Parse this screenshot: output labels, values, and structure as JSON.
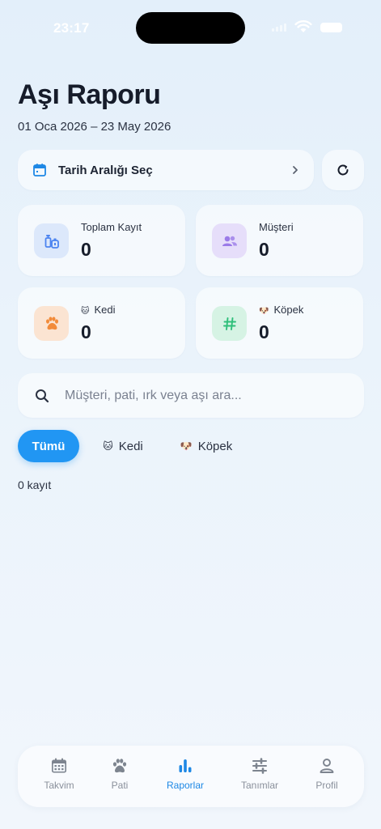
{
  "status_bar": {
    "time": "23:17"
  },
  "header": {
    "title": "Aşı Raporu",
    "date_range": "01 Oca 2026 – 23 May 2026"
  },
  "date_picker": {
    "label": "Tarih Aralığı Seç"
  },
  "stats": [
    {
      "label": "Toplam Kayıt",
      "value": "0",
      "icon": "vaccine-icon",
      "color": "#4c84f0"
    },
    {
      "label": "Müşteri",
      "value": "0",
      "icon": "group-icon",
      "color": "#9b7be8"
    },
    {
      "label": "Kedi",
      "emoji": "🐱",
      "value": "0",
      "icon": "paw-icon",
      "color": "#f28b3a"
    },
    {
      "label": "Köpek",
      "emoji": "🐶",
      "value": "0",
      "icon": "hash-icon",
      "color": "#2fbf7a"
    }
  ],
  "search": {
    "placeholder": "Müşteri, pati, ırk veya aşı ara..."
  },
  "filters": [
    {
      "label": "Tümü",
      "active": true
    },
    {
      "label": "Kedi",
      "emoji": "🐱"
    },
    {
      "label": "Köpek",
      "emoji": "🐶"
    }
  ],
  "result_count": "0 kayıt",
  "tabs": [
    {
      "label": "Takvim",
      "icon": "calendar-icon"
    },
    {
      "label": "Pati",
      "icon": "paw-icon"
    },
    {
      "label": "Raporlar",
      "icon": "bar-chart-icon",
      "active": true
    },
    {
      "label": "Tanımlar",
      "icon": "sliders-icon"
    },
    {
      "label": "Profil",
      "icon": "person-icon"
    }
  ],
  "colors": {
    "accent": "#2196f3",
    "tab_active": "#1e88e5",
    "tab_inactive": "#7d848f"
  }
}
